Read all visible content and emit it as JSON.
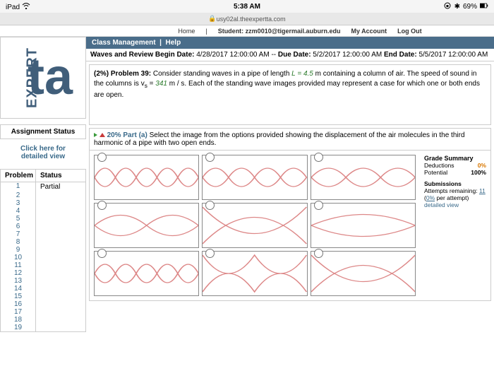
{
  "ios": {
    "device": "iPad",
    "time": "5:38 AM",
    "battery": "69%"
  },
  "url": "usy02al.theexpertta.com",
  "topnav": {
    "home": "Home",
    "student": "Student: zzm0010@tigermail.auburn.edu",
    "account": "My Account",
    "logout": "Log Out"
  },
  "logo": {
    "vert": "EXPERT",
    "ta": "ta"
  },
  "sidebar": {
    "assignHeader": "Assignment Status",
    "detail1": "Click here for",
    "detail2": "detailed view",
    "colProblem": "Problem",
    "colStatus": "Status",
    "rows": [
      {
        "n": "1",
        "s": "Partial"
      },
      {
        "n": "2",
        "s": ""
      },
      {
        "n": "3",
        "s": ""
      },
      {
        "n": "4",
        "s": ""
      },
      {
        "n": "5",
        "s": ""
      },
      {
        "n": "6",
        "s": ""
      },
      {
        "n": "7",
        "s": ""
      },
      {
        "n": "8",
        "s": ""
      },
      {
        "n": "9",
        "s": ""
      },
      {
        "n": "10",
        "s": ""
      },
      {
        "n": "11",
        "s": ""
      },
      {
        "n": "12",
        "s": ""
      },
      {
        "n": "13",
        "s": ""
      },
      {
        "n": "14",
        "s": ""
      },
      {
        "n": "15",
        "s": ""
      },
      {
        "n": "16",
        "s": ""
      },
      {
        "n": "17",
        "s": ""
      },
      {
        "n": "18",
        "s": ""
      },
      {
        "n": "19",
        "s": ""
      }
    ]
  },
  "classMgmt": {
    "label": "Class Management",
    "help": "Help"
  },
  "dates": {
    "title": "Waves and Review",
    "bl": "Begin Date:",
    "bv": "4/28/2017 12:00:00 AM --",
    "dl": "Due Date:",
    "dv": "5/2/2017 12:00:00 AM",
    "el": "End Date:",
    "ev": "5/5/2017 12:00:00 AM"
  },
  "problem": {
    "pct": "(2%) Problem 39:",
    "t1": " Consider standing waves in a pipe of length ",
    "L": "L = 4.5",
    "t2": " m containing a column of air. The speed of sound in the columns is v",
    "sub": "s",
    "eq": " = ",
    "v": "341",
    "t3": " m / s. Each of the standing wave images provided may represent a case for which one or both ends are open."
  },
  "part": {
    "pct": "20% Part (a)",
    "text": " Select the image from the options provided showing the displacement of the air molecules in the third harmonic of a pipe with two open ends."
  },
  "grade": {
    "title": "Grade Summary",
    "dedL": "Deductions",
    "dedV": "0%",
    "potL": "Potential",
    "potV": "100%",
    "sub": "Submissions",
    "attL": "Attempts remaining:",
    "attV": "11",
    "per1": "(",
    "perPct": "0%",
    "per2": " per attempt)",
    "detail": "detailed view"
  }
}
